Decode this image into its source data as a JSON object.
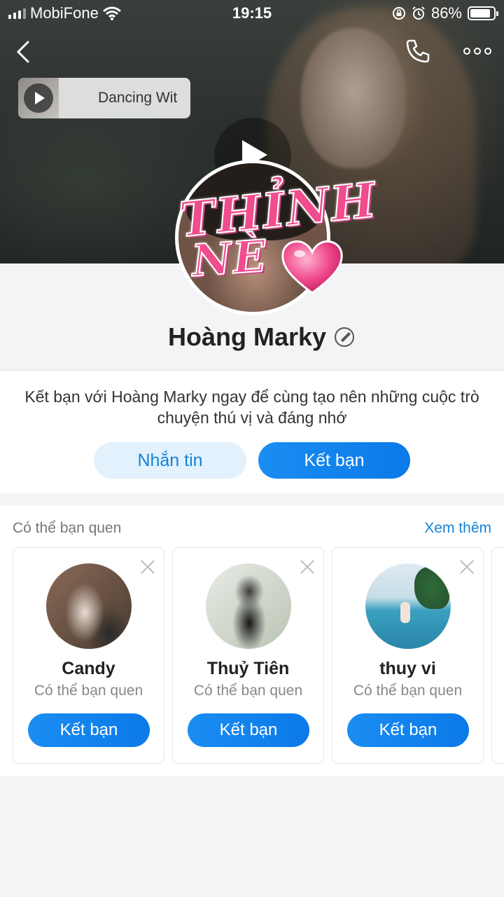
{
  "status_bar": {
    "carrier": "MobiFone",
    "time": "19:15",
    "battery": "86%",
    "battery_level": 0.86
  },
  "nav": {
    "back_icon": "chevron-left-icon",
    "call_icon": "phone-icon",
    "more_icon": "more-dots-icon"
  },
  "music": {
    "title": "Dancing Wit"
  },
  "sticker": {
    "line1": "THỈNH",
    "line2": "NÈ"
  },
  "profile": {
    "name": "Hoàng Marky"
  },
  "friend_request": {
    "text": "Kết bạn với Hoàng Marky ngay để cùng tạo nên những cuộc trò chuyện thú vị và đáng nhớ",
    "message_label": "Nhắn tin",
    "add_label": "Kết bạn"
  },
  "suggestions": {
    "title": "Có thể bạn quen",
    "see_more": "Xem thêm",
    "items": [
      {
        "name": "Candy",
        "subtitle": "Có thể bạn quen",
        "button": "Kết bạn"
      },
      {
        "name": "Thuỷ Tiên",
        "subtitle": "Có thể bạn quen",
        "button": "Kết bạn"
      },
      {
        "name": "thuy vi",
        "subtitle": "Có thể bạn quen",
        "button": "Kết bạn"
      }
    ]
  },
  "colors": {
    "accent": "#0b79e8",
    "accent_light": "#e2f1fc",
    "link": "#1583d8",
    "sticker_pink": "#f04c8e"
  }
}
